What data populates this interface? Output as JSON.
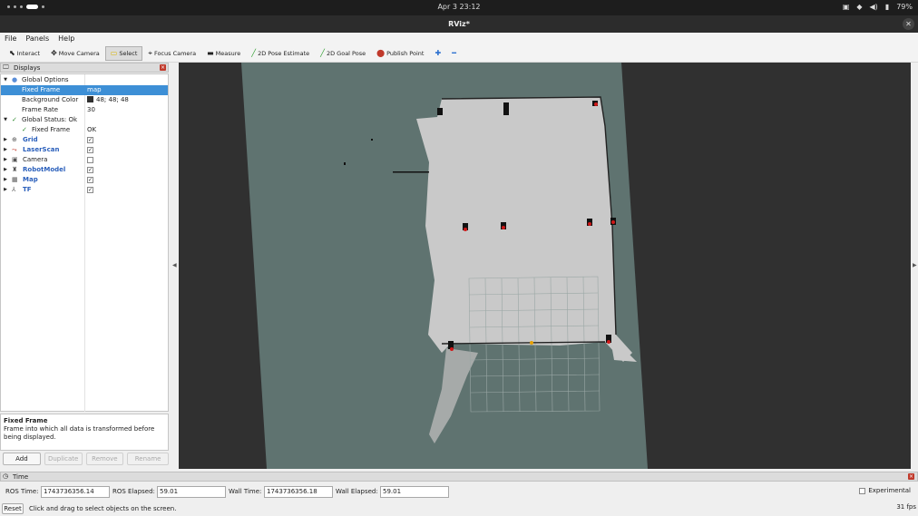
{
  "system_bar": {
    "date_time": "Apr 3  23:12",
    "battery": "79%"
  },
  "window": {
    "title": "RViz*"
  },
  "menu": [
    {
      "label": "File"
    },
    {
      "label": "Panels"
    },
    {
      "label": "Help"
    }
  ],
  "toolbar": {
    "interact": "Interact",
    "move_camera": "Move Camera",
    "select": "Select",
    "focus_camera": "Focus Camera",
    "measure": "Measure",
    "pose_estimate": "2D Pose Estimate",
    "goal_pose": "2D Goal Pose",
    "publish_point": "Publish Point"
  },
  "displays": {
    "title": "Displays",
    "global_options": "Global Options",
    "fixed_frame_label": "Fixed Frame",
    "fixed_frame_value": "map",
    "background_color_label": "Background Color",
    "background_color_value": "48; 48; 48",
    "frame_rate_label": "Frame Rate",
    "frame_rate_value": "30",
    "global_status_label": "Global Status: Ok",
    "status_fixed_frame_label": "Fixed Frame",
    "status_fixed_frame_value": "OK",
    "items": [
      {
        "label": "Grid",
        "checked": true
      },
      {
        "label": "LaserScan",
        "checked": true
      },
      {
        "label": "Camera",
        "checked": false
      },
      {
        "label": "RobotModel",
        "checked": true
      },
      {
        "label": "Map",
        "checked": true
      },
      {
        "label": "TF",
        "checked": true
      }
    ]
  },
  "description": {
    "title": "Fixed Frame",
    "text": "Frame into which all data is transformed before being displayed."
  },
  "buttons": {
    "add": "Add",
    "duplicate": "Duplicate",
    "remove": "Remove",
    "rename": "Rename"
  },
  "time_panel": {
    "title": "Time",
    "ros_time_label": "ROS Time:",
    "ros_time_value": "1743736356.14",
    "ros_elapsed_label": "ROS Elapsed:",
    "ros_elapsed_value": "59.01",
    "wall_time_label": "Wall Time:",
    "wall_time_value": "1743736356.18",
    "wall_elapsed_label": "Wall Elapsed:",
    "wall_elapsed_value": "59.01",
    "experimental_label": "Experimental"
  },
  "status": {
    "reset": "Reset",
    "message": "Click and drag to select objects on the screen.",
    "fps": "31 fps"
  },
  "colors": {
    "background": "#303030",
    "selection": "#3d8fd6",
    "map_unknown": "#5f7370",
    "map_free": "#c9c9c9"
  }
}
